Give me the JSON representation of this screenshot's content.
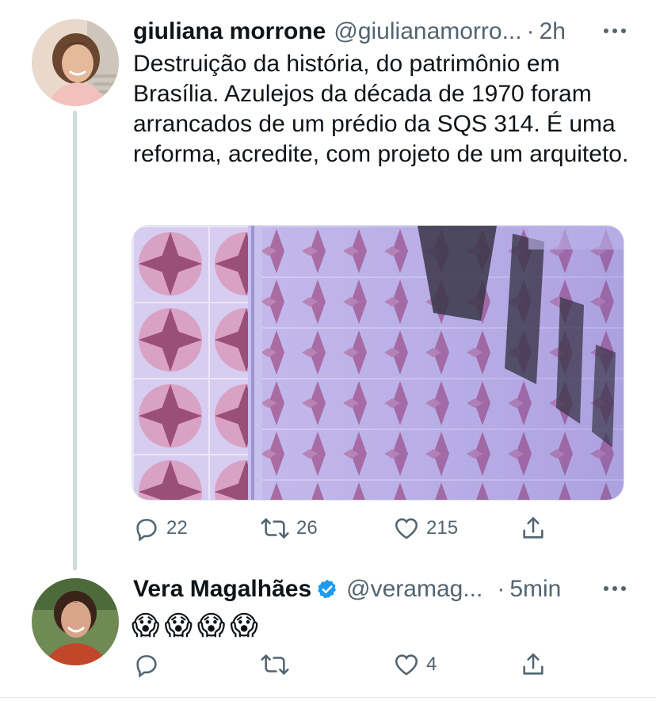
{
  "tweets": [
    {
      "name": "giuliana morrone",
      "handle": "@giulianamorro...",
      "separator": "·",
      "time": "2h",
      "text": "Destruição da história, do patrimônio em Brasília. Azulejos da década de 1970 foram arrancados de um prédio da SQS 314. É uma reforma, acredite, com projeto de um arquiteto.",
      "media_icon": "tiled-wall-photo",
      "stats": {
        "replies": "22",
        "retweets": "26",
        "likes": "215"
      }
    },
    {
      "name": "Vera Magalhães",
      "handle": "@veramag...",
      "separator": "·",
      "time": "5min",
      "verified": true,
      "text_emoji": "😱😱😱😱",
      "stats": {
        "replies": "",
        "retweets": "",
        "likes": "4"
      }
    }
  ],
  "colors": {
    "text": "#0f1419",
    "muted": "#536471",
    "verified": "#1d9bf0",
    "thread_line": "#cfd9de"
  }
}
